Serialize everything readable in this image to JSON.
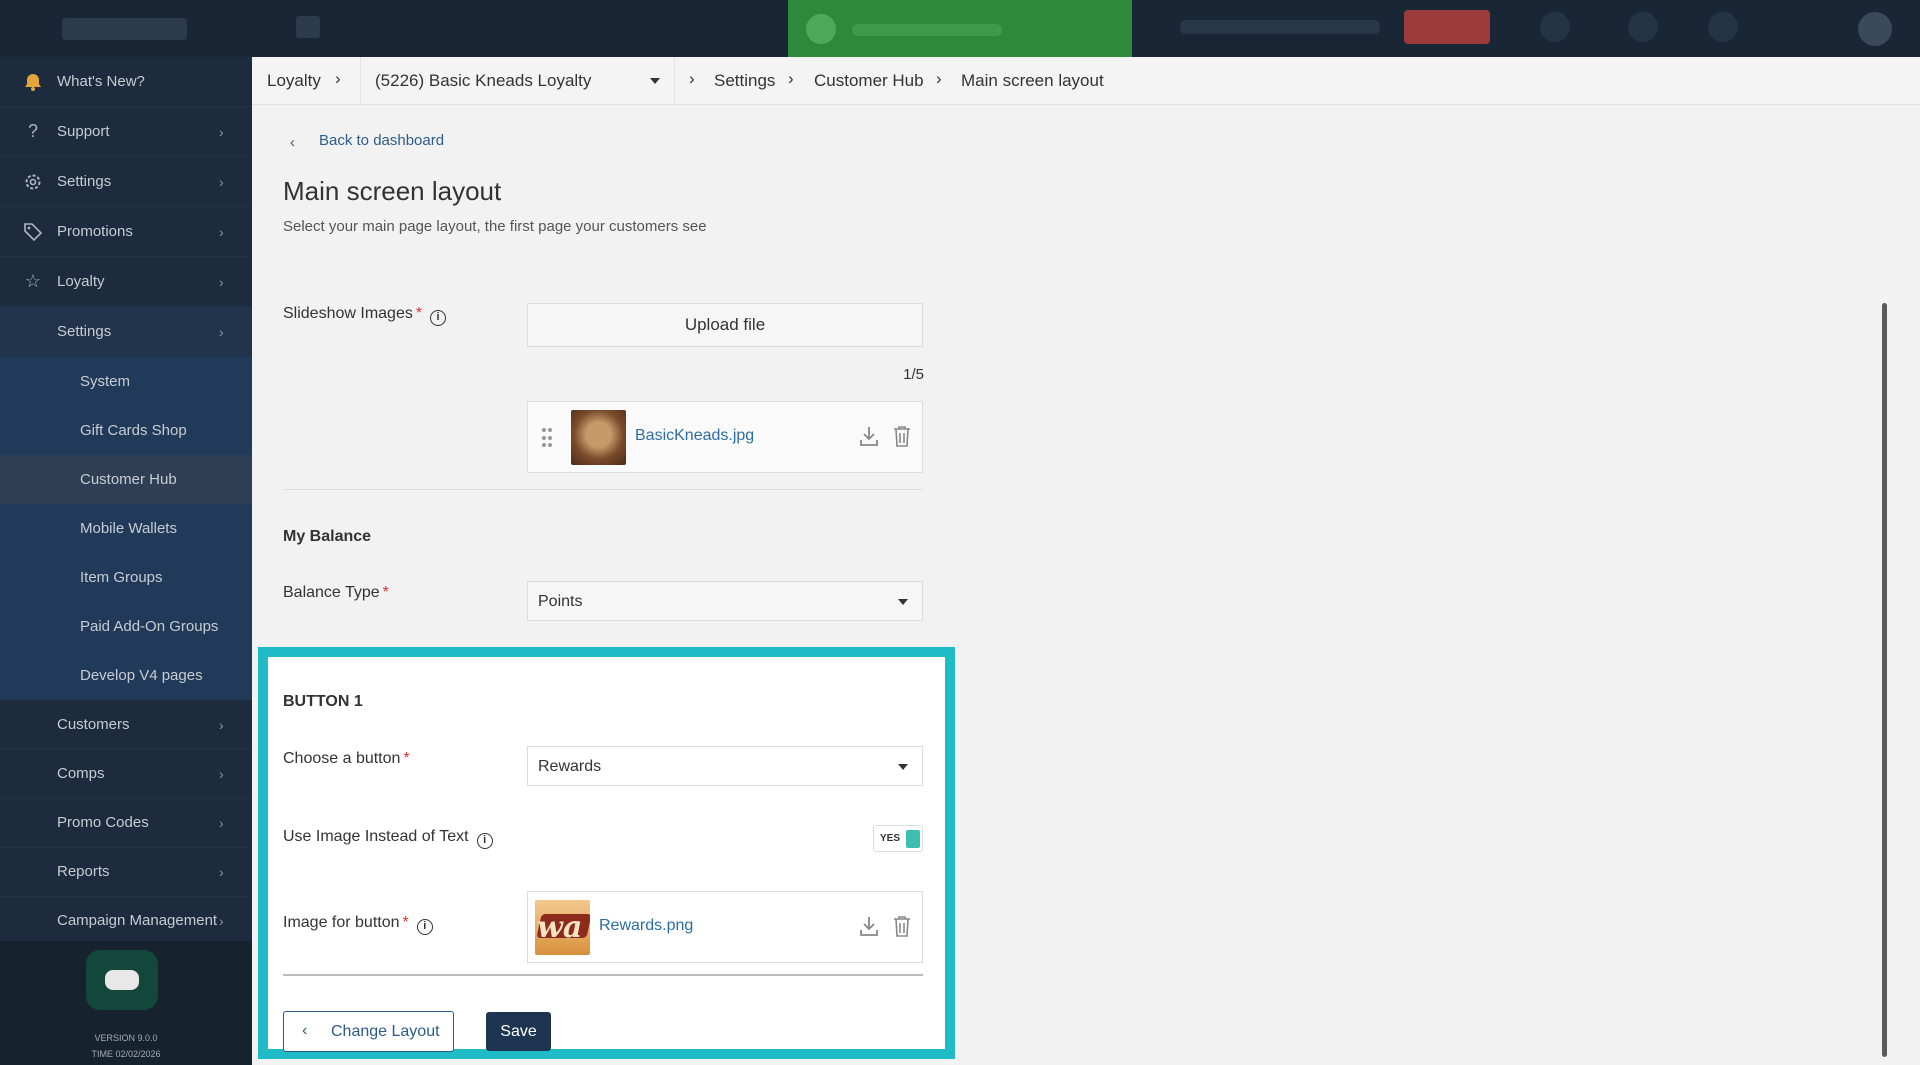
{
  "colors": {
    "accent": "#1fbcc7",
    "primary": "#1e3552",
    "link": "#2c6da6",
    "toast": "#2e8a3a"
  },
  "sidebar": {
    "items": [
      {
        "label": "What's New?",
        "icon": "bell-icon"
      },
      {
        "label": "Support",
        "icon": "question-icon"
      },
      {
        "label": "Settings",
        "icon": "gear-icon"
      },
      {
        "label": "Promotions",
        "icon": "tag-icon"
      },
      {
        "label": "Loyalty",
        "icon": "star-icon"
      },
      {
        "label": "Settings"
      }
    ],
    "subitems": [
      "System",
      "Gift Cards Shop",
      "Customer Hub",
      "Mobile Wallets",
      "Item Groups",
      "Paid Add-On Groups",
      "Develop V4 pages"
    ],
    "more": [
      "Customers",
      "Comps",
      "Promo Codes",
      "Reports",
      "Campaign Management"
    ],
    "version": "VERSION 9.0.0",
    "time": "TIME 02/02/2026"
  },
  "breadcrumb": {
    "root": "Loyalty",
    "program": "(5226) Basic Kneads Loyalty",
    "settings": "Settings",
    "hub": "Customer Hub",
    "current": "Main screen layout"
  },
  "page": {
    "back": "Back to dashboard",
    "title": "Main screen layout",
    "subtitle": "Select your main page layout, the first page your customers see"
  },
  "slideshow": {
    "label": "Slideshow Images",
    "upload": "Upload file",
    "count": "1/5",
    "file": "BasicKneads.jpg"
  },
  "balance": {
    "section": "My Balance",
    "label": "Balance Type",
    "value": "Points"
  },
  "button1": {
    "section": "BUTTON 1",
    "choose_label": "Choose a button",
    "choose_value": "Rewards",
    "use_image_label": "Use Image Instead of Text",
    "toggle": "YES",
    "image_label": "Image for button",
    "file": "Rewards.png",
    "thumb_text": "wa"
  },
  "actions": {
    "change_layout": "Change Layout",
    "save": "Save"
  },
  "icons": [
    "bell-icon",
    "question-icon",
    "gear-icon",
    "tag-icon",
    "star-icon",
    "chevron-right-icon",
    "chevron-left-icon",
    "caret-down-icon",
    "info-icon",
    "drag-handle-icon",
    "download-icon",
    "trash-icon",
    "chat-icon"
  ]
}
